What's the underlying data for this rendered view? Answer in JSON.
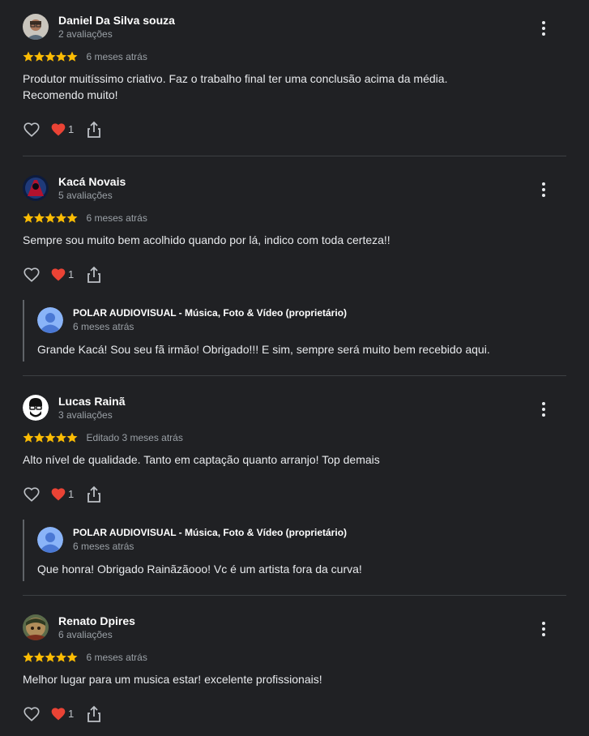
{
  "colors": {
    "background": "#202124",
    "star": "#fbbc04",
    "heart": "#ea4335",
    "muted_text": "#9aa0a6",
    "divider": "#3c4043",
    "owner_avatar": "#8ab4f8"
  },
  "icons": {
    "like": "heart-outline-icon",
    "reaction": "red-heart-icon",
    "share": "share-icon",
    "menu": "more-vert-icon",
    "star": "star-icon"
  },
  "reviews": [
    {
      "name": "Daniel Da Silva souza",
      "review_count": "2 avaliações",
      "rating": 5,
      "time": "6 meses atrás",
      "text_lines": [
        "Produtor muitíssimo criativo. Faz o trabalho final ter uma conclusão acima da média.",
        "Recomendo muito!"
      ],
      "reactions": "1"
    },
    {
      "name": "Kacá Novais",
      "review_count": "5 avaliações",
      "rating": 5,
      "time": "6 meses atrás",
      "text_lines": [
        "Sempre sou muito bem acolhido quando por lá, indico com toda certeza!!"
      ],
      "reactions": "1",
      "reply": {
        "owner": "POLAR AUDIOVISUAL - Música, Foto & Vídeo (proprietário)",
        "time": "6 meses atrás",
        "text": "Grande Kacá! Sou seu fã irmão! Obrigado!!! E sim, sempre será muito bem recebido aqui."
      }
    },
    {
      "name": "Lucas Rainã",
      "review_count": "3 avaliações",
      "rating": 5,
      "time": "Editado 3 meses atrás",
      "text_lines": [
        "Alto nível de qualidade. Tanto em captação quanto arranjo! Top demais"
      ],
      "reactions": "1",
      "reply": {
        "owner": "POLAR AUDIOVISUAL - Música, Foto & Vídeo (proprietário)",
        "time": "6 meses atrás",
        "text": "Que honra! Obrigado Rainãzãooo! Vc é um artista fora da curva!"
      }
    },
    {
      "name": "Renato Dpires",
      "review_count": "6 avaliações",
      "rating": 5,
      "time": "6 meses atrás",
      "text_lines": [
        "Melhor lugar para um musica estar! excelente profissionais!"
      ],
      "reactions": "1"
    }
  ]
}
